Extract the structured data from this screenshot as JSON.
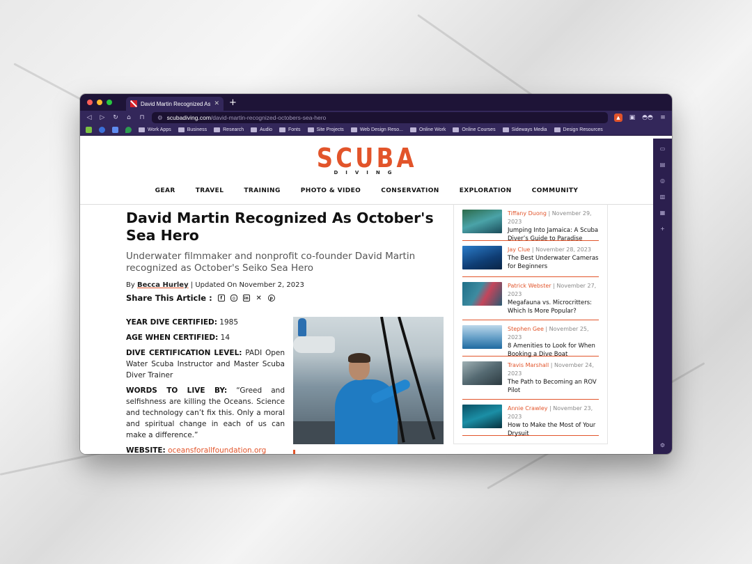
{
  "browser": {
    "tab_title": "David Martin Recognized As O",
    "url_domain": "scubadiving.com",
    "url_path": "/david-martin-recognized-octobers-sea-hero",
    "bookmarks": [
      "Work Apps",
      "Business",
      "Research",
      "Audio",
      "Fonts",
      "Site Projects",
      "Web Design Reso...",
      "Online Work",
      "Online Courses",
      "Sideways Media",
      "Design Resources"
    ]
  },
  "site": {
    "logo_main": "SCUBA",
    "logo_sub": "DIVING",
    "nav": [
      "GEAR",
      "TRAVEL",
      "TRAINING",
      "PHOTO & VIDEO",
      "CONSERVATION",
      "EXPLORATION",
      "COMMUNITY"
    ]
  },
  "article": {
    "headline": "David Martin Recognized As October's Sea Hero",
    "subhead": "Underwater filmmaker and nonprofit co-founder David Martin recognized as October's Seiko Sea Hero",
    "by_prefix": "By ",
    "author": "Becca Hurley",
    "updated": " | Updated On November 2, 2023",
    "share_label": "Share This Article :",
    "facts": [
      {
        "label": "YEAR DIVE CERTIFIED:",
        "value": " 1985"
      },
      {
        "label": "AGE WHEN CERTIFIED:",
        "value": " 14"
      },
      {
        "label": "DIVE CERTIFICATION LEVEL:",
        "value": " PADI Open Water Scuba Instructor and Master Scuba Diver Trainer"
      },
      {
        "label": "WORDS TO LIVE BY:",
        "value": " “Greed and selfishness are killing the Oceans. Science and technology can’t fix this. Only a moral and spiritual change in each of us can make a difference.”"
      }
    ],
    "website_label": "WEBSITE:",
    "website_url": "oceansforallfoundation.org"
  },
  "sidebar": {
    "items": [
      {
        "author": "Tiffany Duong",
        "date": " | November 29, 2023",
        "title": "Jumping Into Jamaica: A Scuba Diver’s Guide to Paradise"
      },
      {
        "author": "Jay Clue",
        "date": " | November 28, 2023",
        "title": "The Best Underwater Cameras for Beginners"
      },
      {
        "author": "Patrick Webster",
        "date": " | November 27, 2023",
        "title": "Megafauna vs. Microcritters: Which Is More Popular?"
      },
      {
        "author": "Stephen Gee",
        "date": " | November 25, 2023",
        "title": "8 Amenities to Look for When Booking a Dive Boat"
      },
      {
        "author": "Travis Marshall",
        "date": " | November 24, 2023",
        "title": "The Path to Becoming an ROV Pilot"
      },
      {
        "author": "Annie Crawley",
        "date": " | November 23, 2023",
        "title": "How to Make the Most of Your Drysuit"
      }
    ]
  }
}
